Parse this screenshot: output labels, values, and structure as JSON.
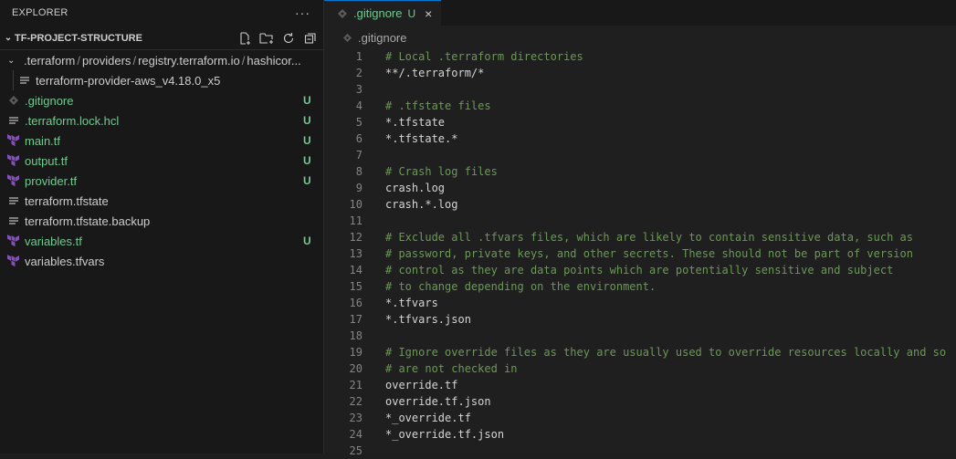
{
  "sidebar": {
    "header": "EXPLORER",
    "more": "···",
    "project": "TF-PROJECT-STRUCTURE",
    "crumbs": [
      ".terraform",
      "providers",
      "registry.terraform.io",
      "hashicor..."
    ],
    "sub_item": "terraform-provider-aws_v4.18.0_x5",
    "files": [
      {
        "name": ".gitignore",
        "badge": "U",
        "icon": "gitignore-icon"
      },
      {
        "name": ".terraform.lock.hcl",
        "badge": "U",
        "icon": "lines-file-icon"
      },
      {
        "name": "main.tf",
        "badge": "U",
        "icon": "terraform-icon"
      },
      {
        "name": "output.tf",
        "badge": "U",
        "icon": "terraform-icon"
      },
      {
        "name": "provider.tf",
        "badge": "U",
        "icon": "terraform-icon"
      },
      {
        "name": "terraform.tfstate",
        "badge": "",
        "icon": "lines-file-icon"
      },
      {
        "name": "terraform.tfstate.backup",
        "badge": "",
        "icon": "lines-file-icon"
      },
      {
        "name": "variables.tf",
        "badge": "U",
        "icon": "terraform-icon"
      },
      {
        "name": "variables.tfvars",
        "badge": "",
        "icon": "terraform-icon"
      }
    ]
  },
  "editor": {
    "tab": {
      "label": ".gitignore",
      "status": "U",
      "close": "×"
    },
    "breadcrumb": ".gitignore",
    "lines": [
      {
        "n": "1",
        "text": "# Local .terraform directories",
        "comment": true
      },
      {
        "n": "2",
        "text": "**/.terraform/*",
        "comment": false
      },
      {
        "n": "3",
        "text": "",
        "comment": false
      },
      {
        "n": "4",
        "text": "# .tfstate files",
        "comment": true
      },
      {
        "n": "5",
        "text": "*.tfstate",
        "comment": false
      },
      {
        "n": "6",
        "text": "*.tfstate.*",
        "comment": false
      },
      {
        "n": "7",
        "text": "",
        "comment": false
      },
      {
        "n": "8",
        "text": "# Crash log files",
        "comment": true
      },
      {
        "n": "9",
        "text": "crash.log",
        "comment": false
      },
      {
        "n": "10",
        "text": "crash.*.log",
        "comment": false
      },
      {
        "n": "11",
        "text": "",
        "comment": false
      },
      {
        "n": "12",
        "text": "# Exclude all .tfvars files, which are likely to contain sensitive data, such as",
        "comment": true
      },
      {
        "n": "13",
        "text": "# password, private keys, and other secrets. These should not be part of version",
        "comment": true
      },
      {
        "n": "14",
        "text": "# control as they are data points which are potentially sensitive and subject",
        "comment": true
      },
      {
        "n": "15",
        "text": "# to change depending on the environment.",
        "comment": true
      },
      {
        "n": "16",
        "text": "*.tfvars",
        "comment": false
      },
      {
        "n": "17",
        "text": "*.tfvars.json",
        "comment": false
      },
      {
        "n": "18",
        "text": "",
        "comment": false
      },
      {
        "n": "19",
        "text": "# Ignore override files as they are usually used to override resources locally and so",
        "comment": true
      },
      {
        "n": "20",
        "text": "# are not checked in",
        "comment": true
      },
      {
        "n": "21",
        "text": "override.tf",
        "comment": false
      },
      {
        "n": "22",
        "text": "override.tf.json",
        "comment": false
      },
      {
        "n": "23",
        "text": "*_override.tf",
        "comment": false
      },
      {
        "n": "24",
        "text": "*_override.tf.json",
        "comment": false
      },
      {
        "n": "25",
        "text": "",
        "comment": false
      }
    ]
  },
  "colors": {
    "untracked": "#73c991",
    "comment": "#6a9955",
    "terraform": "#844fba",
    "accent": "#0078d4"
  }
}
